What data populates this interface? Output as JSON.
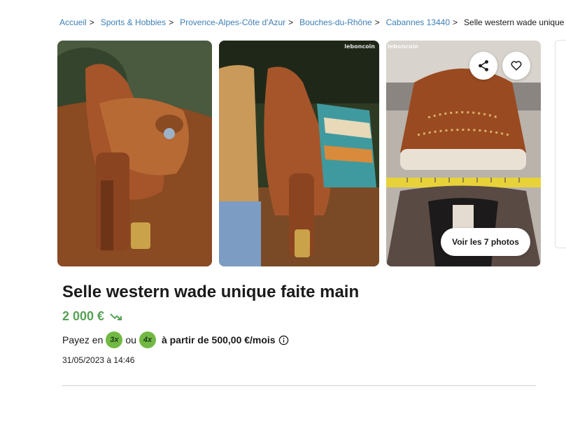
{
  "breadcrumb": {
    "items": [
      "Accueil",
      "Sports & Hobbies",
      "Provence-Alpes-Côte d'Azur",
      "Bouches-du-Rhône",
      "Cabannes 13440"
    ],
    "separator": ">",
    "current": "Selle western wade unique faite main"
  },
  "gallery": {
    "watermark": "leboncoin",
    "see_photos_label": "Voir les 7 photos",
    "icons": [
      "share-icon",
      "heart-icon"
    ]
  },
  "listing": {
    "title": "Selle western wade unique faite main",
    "price": "2 000 €",
    "payment": {
      "prefix": "Payez en",
      "badge_3x": "3x",
      "or": "ou",
      "badge_4x": "4x",
      "details": "à partir de 500,00 €/mois"
    },
    "date": "31/05/2023 à 14:46"
  },
  "colors": {
    "link": "#3d7fb6",
    "price": "#56a256",
    "badge": "#72b944"
  }
}
